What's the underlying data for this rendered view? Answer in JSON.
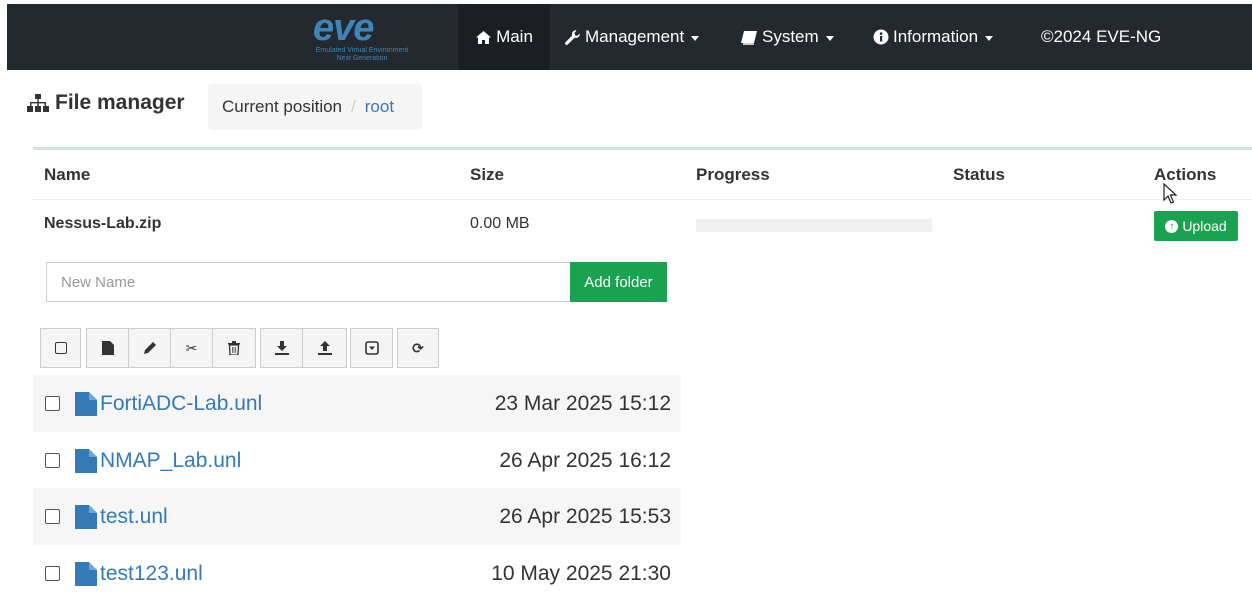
{
  "logo": {
    "word": "eve",
    "tagline": "Emulated Virtual Environment",
    "sub": "Next Generation"
  },
  "nav": {
    "main": "Main",
    "management": "Management",
    "system": "System",
    "information": "Information",
    "copyright": "©2024 EVE-NG"
  },
  "header": {
    "title": "File manager",
    "breadcrumb_label": "Current position",
    "breadcrumb_current": "root"
  },
  "upload_table": {
    "columns": [
      "Name",
      "Size",
      "Progress",
      "Status",
      "Actions"
    ],
    "row": {
      "name": "Nessus-Lab.zip",
      "size": "0.00 MB",
      "progress": 0,
      "status": "",
      "action": "Upload"
    }
  },
  "new_folder": {
    "placeholder": "New Name",
    "button": "Add folder"
  },
  "toolbar": [
    "select-all",
    "new-file",
    "rename",
    "cut",
    "delete",
    "download",
    "upload",
    "open",
    "refresh"
  ],
  "files": [
    {
      "name": "FortiADC-Lab.unl",
      "date": "23 Mar 2025 15:12"
    },
    {
      "name": "NMAP_Lab.unl",
      "date": "26 Apr 2025 16:12"
    },
    {
      "name": "test.unl",
      "date": "26 Apr 2025 15:53"
    },
    {
      "name": "test123.unl",
      "date": "10 May 2025 21:30"
    }
  ],
  "colors": {
    "navbar": "#24292f",
    "accent": "#1aa251",
    "link": "#337ab7",
    "logo": "#3e86b8"
  }
}
